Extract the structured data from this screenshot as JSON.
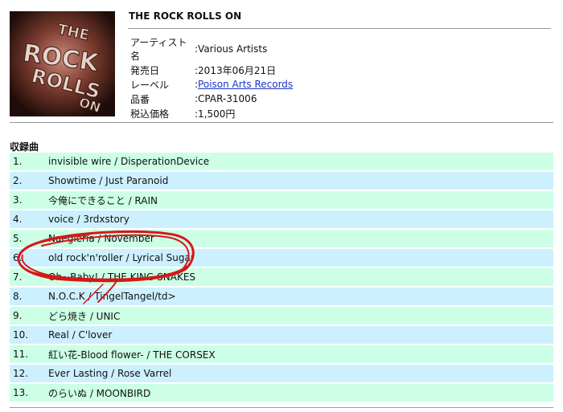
{
  "album": {
    "title": "THE ROCK ROLLS ON",
    "cover_text": "THE ROCK ROLLS ON",
    "details": [
      {
        "label": "アーティスト名",
        "value": ":Various Artists",
        "link": false
      },
      {
        "label": "発売日",
        "value": ":2013年06月21日",
        "link": false
      },
      {
        "label": "レーベル",
        "prefix": ":",
        "value": "Poison Arts Records",
        "link": true
      },
      {
        "label": "品番",
        "value": ":CPAR-31006",
        "link": false
      },
      {
        "label": "税込価格",
        "value": ":1,500円",
        "link": false
      }
    ]
  },
  "tracklist": {
    "heading": "収録曲",
    "tracks": [
      {
        "num": "1.",
        "title": "invisible wire / DisperationDevice"
      },
      {
        "num": "2.",
        "title": "Showtime / Just Paranoid"
      },
      {
        "num": "3.",
        "title": "今俺にできること / RAIN"
      },
      {
        "num": "4.",
        "title": "voice / 3rdxstory"
      },
      {
        "num": "5.",
        "title": "Naegleria / November"
      },
      {
        "num": "6.",
        "title": "old rock'n'roller / Lyrical Sugar"
      },
      {
        "num": "7.",
        "title": "Oh~Baby! / THE KING SNAKES"
      },
      {
        "num": "8.",
        "title": "N.O.C.K / TingelTangel/td>"
      },
      {
        "num": "9.",
        "title": "どら焼き / UNIC"
      },
      {
        "num": "10.",
        "title": "Real / C'lover"
      },
      {
        "num": "11.",
        "title": "紅い花-Blood flower- / THE CORSEX"
      },
      {
        "num": "12.",
        "title": "Ever Lasting / Rose Varrel"
      },
      {
        "num": "13.",
        "title": "のらいぬ / MOONBIRD"
      }
    ]
  },
  "colors": {
    "row_even": "#ccffe5",
    "row_odd": "#cdf0ff",
    "link": "#1a35c8",
    "scribble": "#d41818"
  }
}
